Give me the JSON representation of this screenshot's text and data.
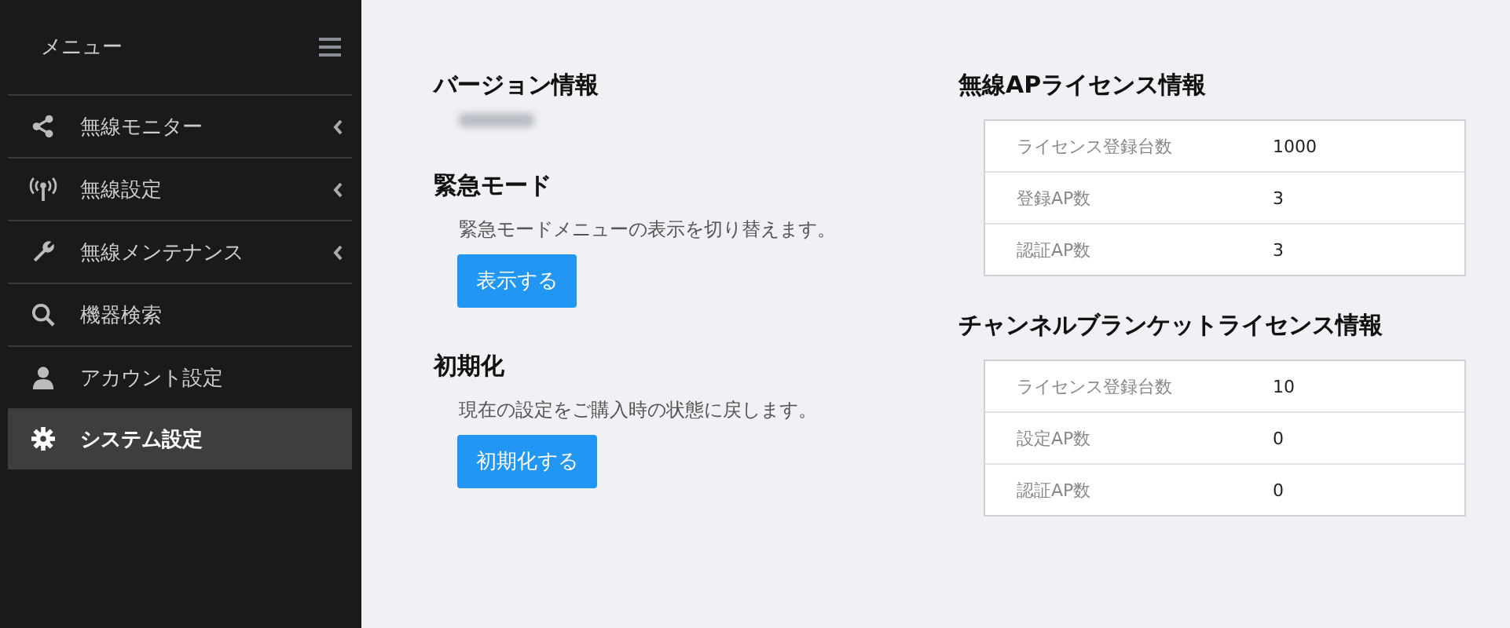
{
  "sidebar": {
    "title": "メニュー",
    "items": [
      {
        "label": "無線モニター",
        "has_submenu": true,
        "selected": false
      },
      {
        "label": "無線設定",
        "has_submenu": true,
        "selected": false
      },
      {
        "label": "無線メンテナンス",
        "has_submenu": true,
        "selected": false
      },
      {
        "label": "機器検索",
        "has_submenu": false,
        "selected": false
      },
      {
        "label": "アカウント設定",
        "has_submenu": false,
        "selected": false
      },
      {
        "label": "システム設定",
        "has_submenu": false,
        "selected": true
      }
    ]
  },
  "sections": [
    {
      "title": "バージョン情報"
    },
    {
      "title": "緊急モード",
      "description": "緊急モードメニューの表示を切り替えます。",
      "button": "表示する"
    },
    {
      "title": "初期化",
      "description": "現在の設定をご購入時の状態に戻します。",
      "button": "初期化する"
    }
  ],
  "license_panels": [
    {
      "title": "無線APライセンス情報",
      "rows": [
        {
          "label": "ライセンス登録台数",
          "value": "1000"
        },
        {
          "label": "登録AP数",
          "value": "3"
        },
        {
          "label": "認証AP数",
          "value": "3"
        }
      ]
    },
    {
      "title": "チャンネルブランケットライセンス情報",
      "rows": [
        {
          "label": "ライセンス登録台数",
          "value": "10"
        },
        {
          "label": "設定AP数",
          "value": "0"
        },
        {
          "label": "認証AP数",
          "value": "0"
        }
      ]
    }
  ]
}
